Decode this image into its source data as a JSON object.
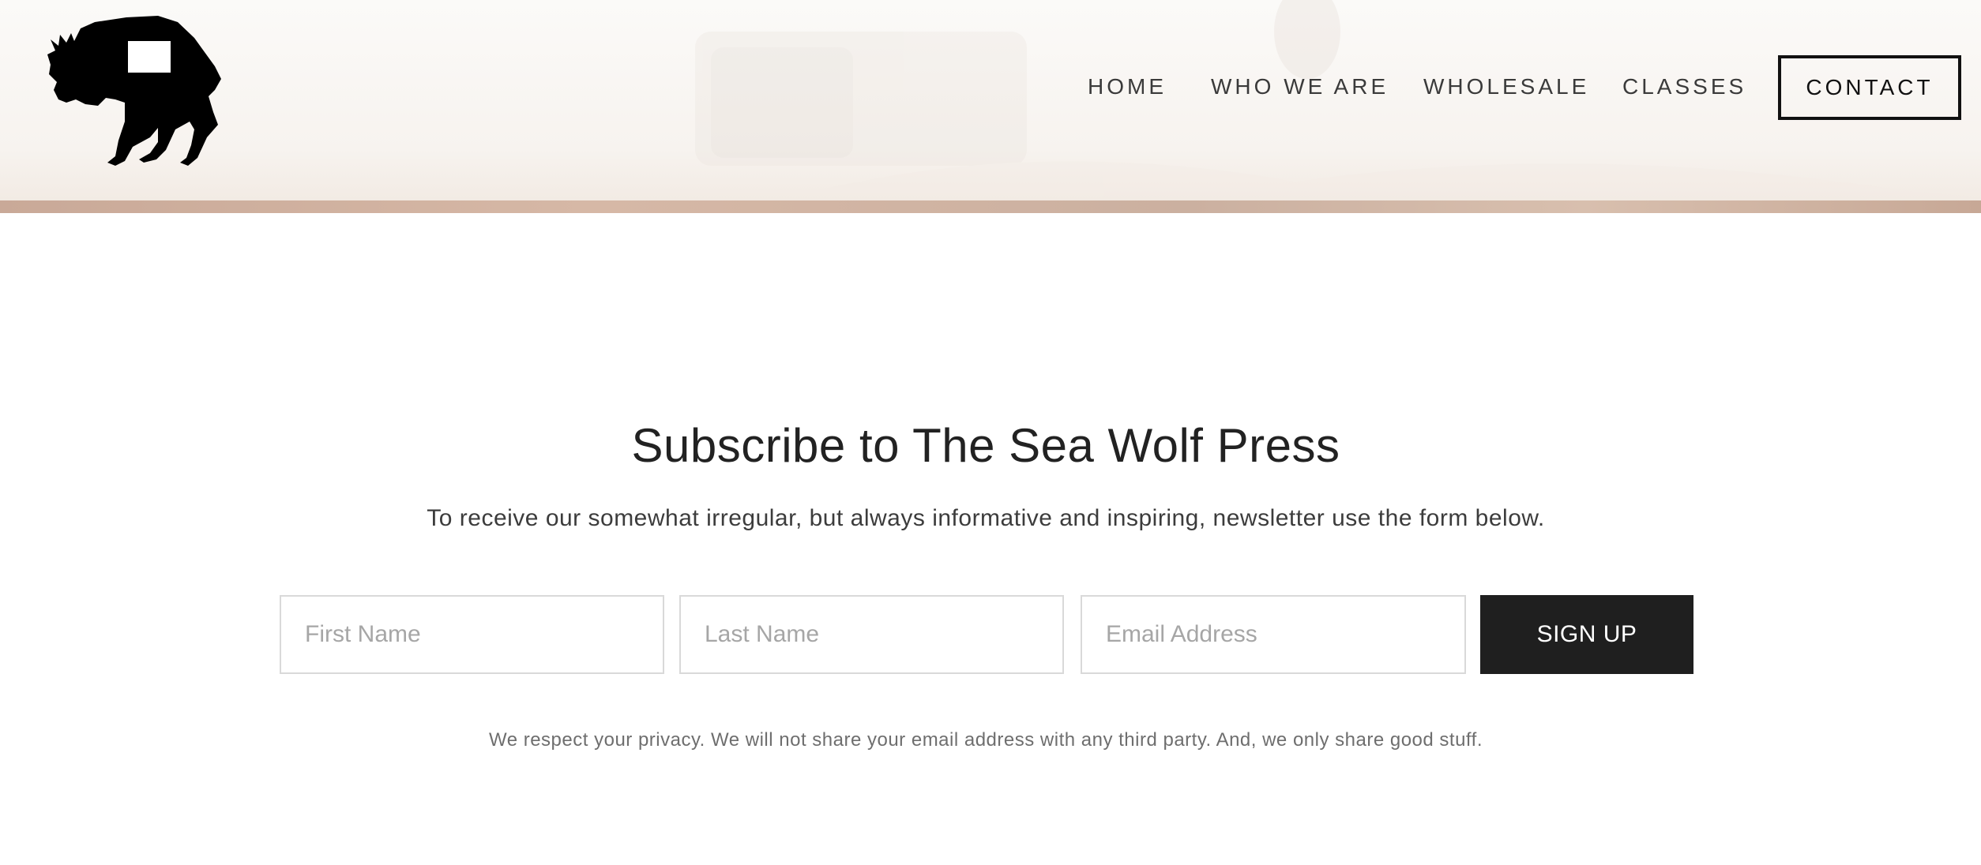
{
  "header": {
    "logo_icon": "wolf-silhouette-icon",
    "nav": [
      {
        "label": "HOME"
      },
      {
        "label": "WHO WE ARE"
      },
      {
        "label": "WHOLESALE"
      },
      {
        "label": "CLASSES"
      }
    ],
    "contact_label": "CONTACT"
  },
  "subscribe": {
    "title": "Subscribe to The Sea Wolf Press",
    "description": "To receive our somewhat irregular, but always informative and inspiring, newsletter use the form below.",
    "first_name": {
      "placeholder": "First Name",
      "value": ""
    },
    "last_name": {
      "placeholder": "Last Name",
      "value": ""
    },
    "email": {
      "placeholder": "Email Address",
      "value": ""
    },
    "submit_label": "SIGN UP",
    "privacy_note": "We respect your privacy. We will not share your email address with any third party. And, we only share good stuff."
  },
  "colors": {
    "button_bg": "#1f1f1f",
    "button_text": "#ffffff",
    "header_strip": "#c9a998",
    "text_dark": "#222222"
  }
}
